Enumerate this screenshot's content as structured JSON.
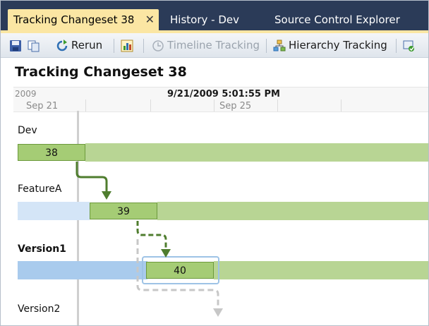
{
  "tabs": [
    {
      "label": "Tracking Changeset 38",
      "active": true,
      "close_glyph": "✕"
    },
    {
      "label": "History - Dev",
      "active": false
    },
    {
      "label": "Source Control Explorer",
      "active": false
    }
  ],
  "toolbar": {
    "items": [
      {
        "icon": "save-icon"
      },
      {
        "icon": "copy-icon"
      },
      {
        "icon": "rerun-icon",
        "label": "Rerun"
      },
      {
        "icon": "chart-icon"
      },
      {
        "icon": "timeline-icon",
        "label": "Timeline Tracking",
        "disabled": true
      },
      {
        "icon": "hierarchy-icon",
        "label": "Hierarchy Tracking"
      },
      {
        "icon": "settings-icon"
      }
    ]
  },
  "page": {
    "title": "Tracking Changeset 38"
  },
  "timeline": {
    "year": "2009",
    "current": "9/21/2009 5:01:55 PM",
    "days": [
      "Sep 21",
      "Sep 25"
    ]
  },
  "branches": [
    {
      "name": "Dev",
      "bold": false,
      "changeset": "38"
    },
    {
      "name": "FeatureA",
      "bold": false,
      "changeset": "39"
    },
    {
      "name": "Version1",
      "bold": true,
      "changeset": "40"
    },
    {
      "name": "Version2",
      "bold": false
    }
  ],
  "colors": {
    "tab_bar": "#2b3b58",
    "active_tab": "#fbe6a3",
    "changeset_fill": "#a5cc75",
    "lane_green": "#b8d594",
    "lane_blue": "#a9cbed",
    "arrow_solid": "#4f7d2e",
    "arrow_pending": "#c7c7c7"
  }
}
